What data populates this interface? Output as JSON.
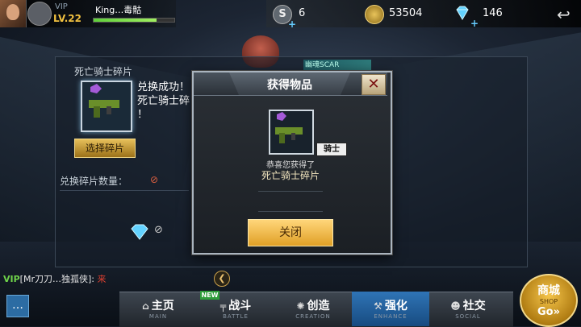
{
  "player": {
    "vip_label": "VIP",
    "level": "LV.22",
    "name": "King…毒骷",
    "xp_progress": 0.78
  },
  "currency": {
    "s_points": "6",
    "gold": "53504",
    "diamonds": "146"
  },
  "panel": {
    "title": "死亡骑士碎片",
    "success_line1": "兑换成功！",
    "success_line2": "死亡骑士碎",
    "success_line3": "！",
    "select_button": "选择碎片",
    "count_label": "兑换碎片数量：",
    "count_value": "⊘",
    "cost_value": "⊘",
    "weapon_tag": "幽魂SCAR"
  },
  "dialog": {
    "title": "获得物品",
    "badge": "骑士",
    "congrats": "恭喜您获得了",
    "item_name": "死亡骑士碎片",
    "close_button": "关闭"
  },
  "chat": {
    "vip": "VIP",
    "message": "[Mr刀刀…独孤侠]:",
    "extra": "来"
  },
  "nav": {
    "items": [
      {
        "label": "主页",
        "sub": "MAIN",
        "icon": "home-icon"
      },
      {
        "label": "战斗",
        "sub": "BATTLE",
        "icon": "gun-icon",
        "new": "NEW"
      },
      {
        "label": "创造",
        "sub": "CREATION",
        "icon": "bulb-icon"
      },
      {
        "label": "强化",
        "sub": "ENHANCE",
        "icon": "hammer-icon",
        "active": true
      },
      {
        "label": "社交",
        "sub": "SOCIAL",
        "icon": "people-icon"
      }
    ]
  },
  "shop": {
    "label": "商城",
    "sub": "SHOP",
    "go": "Go»"
  },
  "colors": {
    "accent_gold": "#e0a026",
    "active_tab": "#2f74b6",
    "new_tag": "#2e9d3a"
  }
}
